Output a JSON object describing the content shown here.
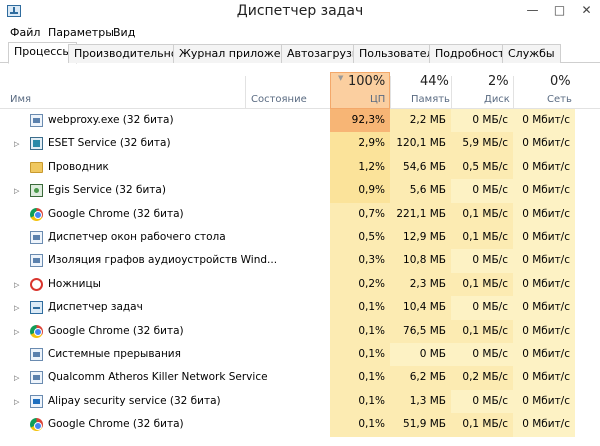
{
  "window": {
    "title": "Диспетчер задач",
    "minimize_glyph": "—",
    "maximize_glyph": "□",
    "close_glyph": "✕"
  },
  "menu": {
    "items": [
      "Файл",
      "Параметры",
      "Вид"
    ]
  },
  "tabs": [
    {
      "label": "Процессы",
      "active": true
    },
    {
      "label": "Производительность",
      "active": false
    },
    {
      "label": "Журнал приложений",
      "active": false
    },
    {
      "label": "Автозагрузка",
      "active": false
    },
    {
      "label": "Пользователи",
      "active": false
    },
    {
      "label": "Подробности",
      "active": false
    },
    {
      "label": "Службы",
      "active": false
    }
  ],
  "columns": {
    "name": "Имя",
    "status": "Состояние",
    "cpu": {
      "pct": "100%",
      "label": "ЦП"
    },
    "mem": {
      "pct": "44%",
      "label": "Память"
    },
    "disk": {
      "pct": "2%",
      "label": "Диск"
    },
    "net": {
      "pct": "0%",
      "label": "Сеть"
    }
  },
  "processes": [
    {
      "name": "webproxy.exe (32 бита)",
      "icon": "generic-app-icon",
      "expandable": false,
      "cpu": "92,3%",
      "mem": "2,2 МБ",
      "disk": "0 МБ/с",
      "net": "0 Мбит/с"
    },
    {
      "name": "ESET Service (32 бита)",
      "icon": "eset-icon",
      "expandable": true,
      "cpu": "2,9%",
      "mem": "120,1 МБ",
      "disk": "5,9 МБ/с",
      "net": "0 Мбит/с"
    },
    {
      "name": "Проводник",
      "icon": "folder-icon",
      "expandable": false,
      "cpu": "1,2%",
      "mem": "54,6 МБ",
      "disk": "0,5 МБ/с",
      "net": "0 Мбит/с"
    },
    {
      "name": "Egis Service (32 бита)",
      "icon": "egis-icon",
      "expandable": true,
      "cpu": "0,9%",
      "mem": "5,6 МБ",
      "disk": "0 МБ/с",
      "net": "0 Мбит/с"
    },
    {
      "name": "Google Chrome (32 бита)",
      "icon": "chrome-icon",
      "expandable": false,
      "cpu": "0,7%",
      "mem": "221,1 МБ",
      "disk": "0,1 МБ/с",
      "net": "0 Мбит/с"
    },
    {
      "name": "Диспетчер окон рабочего стола",
      "icon": "generic-app-icon",
      "expandable": false,
      "cpu": "0,5%",
      "mem": "12,9 МБ",
      "disk": "0,1 МБ/с",
      "net": "0 Мбит/с"
    },
    {
      "name": "Изоляция графов аудиоустройств Wind...",
      "icon": "generic-app-icon",
      "expandable": false,
      "cpu": "0,3%",
      "mem": "10,8 МБ",
      "disk": "0 МБ/с",
      "net": "0 Мбит/с"
    },
    {
      "name": "Ножницы",
      "icon": "scissors-icon",
      "expandable": true,
      "cpu": "0,2%",
      "mem": "2,3 МБ",
      "disk": "0,1 МБ/с",
      "net": "0 Мбит/с"
    },
    {
      "name": "Диспетчер задач",
      "icon": "task-manager-icon",
      "expandable": true,
      "cpu": "0,1%",
      "mem": "10,4 МБ",
      "disk": "0 МБ/с",
      "net": "0 Мбит/с"
    },
    {
      "name": "Google Chrome (32 бита)",
      "icon": "chrome-icon",
      "expandable": true,
      "cpu": "0,1%",
      "mem": "76,5 МБ",
      "disk": "0,1 МБ/с",
      "net": "0 Мбит/с"
    },
    {
      "name": "Системные прерывания",
      "icon": "generic-app-icon",
      "expandable": false,
      "cpu": "0,1%",
      "mem": "0 МБ",
      "disk": "0 МБ/с",
      "net": "0 Мбит/с"
    },
    {
      "name": "Qualcomm Atheros Killer Network Service",
      "icon": "generic-app-icon",
      "expandable": true,
      "cpu": "0,1%",
      "mem": "6,2 МБ",
      "disk": "0,2 МБ/с",
      "net": "0 Мбит/с"
    },
    {
      "name": "Alipay security service (32 бита)",
      "icon": "alipay-icon",
      "expandable": true,
      "cpu": "0,1%",
      "mem": "1,3 МБ",
      "disk": "0 МБ/с",
      "net": "0 Мбит/с"
    },
    {
      "name": "Google Chrome (32 бита)",
      "icon": "chrome-icon",
      "expandable": false,
      "cpu": "0,1%",
      "mem": "51,9 МБ",
      "disk": "0,1 МБ/с",
      "net": "0 Мбит/с"
    }
  ],
  "colors": {
    "cpu_hot": "#f7b575",
    "cpu_warm": "#fbe39a",
    "cpu_light": "#fcebb2",
    "resource_bg": "#fdf2c4",
    "cpu_header": "#fbcfa0"
  }
}
